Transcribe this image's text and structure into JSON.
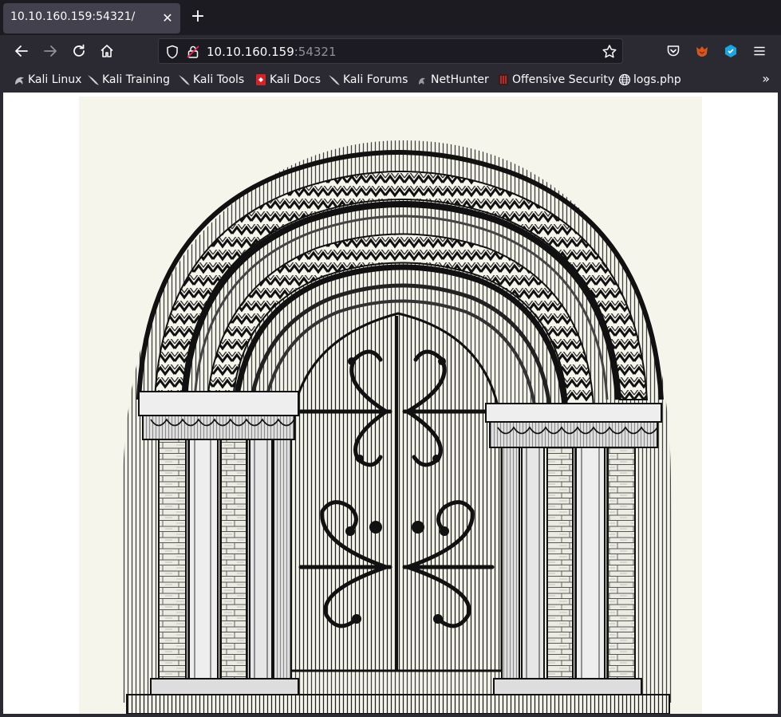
{
  "tab": {
    "title": "10.10.160.159:54321/",
    "close_icon": "close-icon",
    "new_tab_icon": "plus-icon"
  },
  "nav": {
    "back_icon": "back-arrow-icon",
    "forward_icon": "forward-arrow-icon",
    "reload_icon": "reload-icon",
    "home_icon": "home-icon"
  },
  "urlbar": {
    "host": "10.10.160.159",
    "port": ":54321",
    "shield_icon": "shield-icon",
    "lock_icon": "insecure-lock-icon",
    "star_icon": "star-icon"
  },
  "toolbar_right": [
    "pocket-icon",
    "foxyproxy-icon",
    "wappalyzer-icon",
    "menu-icon"
  ],
  "bookmarks": [
    {
      "label": "Kali Linux",
      "icon": "kali-dragon-icon"
    },
    {
      "label": "Kali Training",
      "icon": "kali-dragon-icon"
    },
    {
      "label": "Kali Tools",
      "icon": "kali-dragon-icon"
    },
    {
      "label": "Kali Docs",
      "icon": "kali-docs-icon"
    },
    {
      "label": "Kali Forums",
      "icon": "kali-dragon-icon"
    },
    {
      "label": "NetHunter",
      "icon": "nethunter-icon"
    },
    {
      "label": "Offensive Security",
      "icon": "offsec-icon"
    },
    {
      "label": "logs.php",
      "icon": "globe-icon"
    }
  ],
  "bookmarks_overflow_icon": "chevron-double-right-icon",
  "colors": {
    "tab_bg": "#42414d",
    "toolbar_bg": "#2b2a33",
    "strip_bg": "#1c1b22",
    "text": "#fbfbfe",
    "port": "#8f8f9d"
  },
  "page_image": {
    "subject": "engraving-of-romanesque-arched-doorway"
  }
}
